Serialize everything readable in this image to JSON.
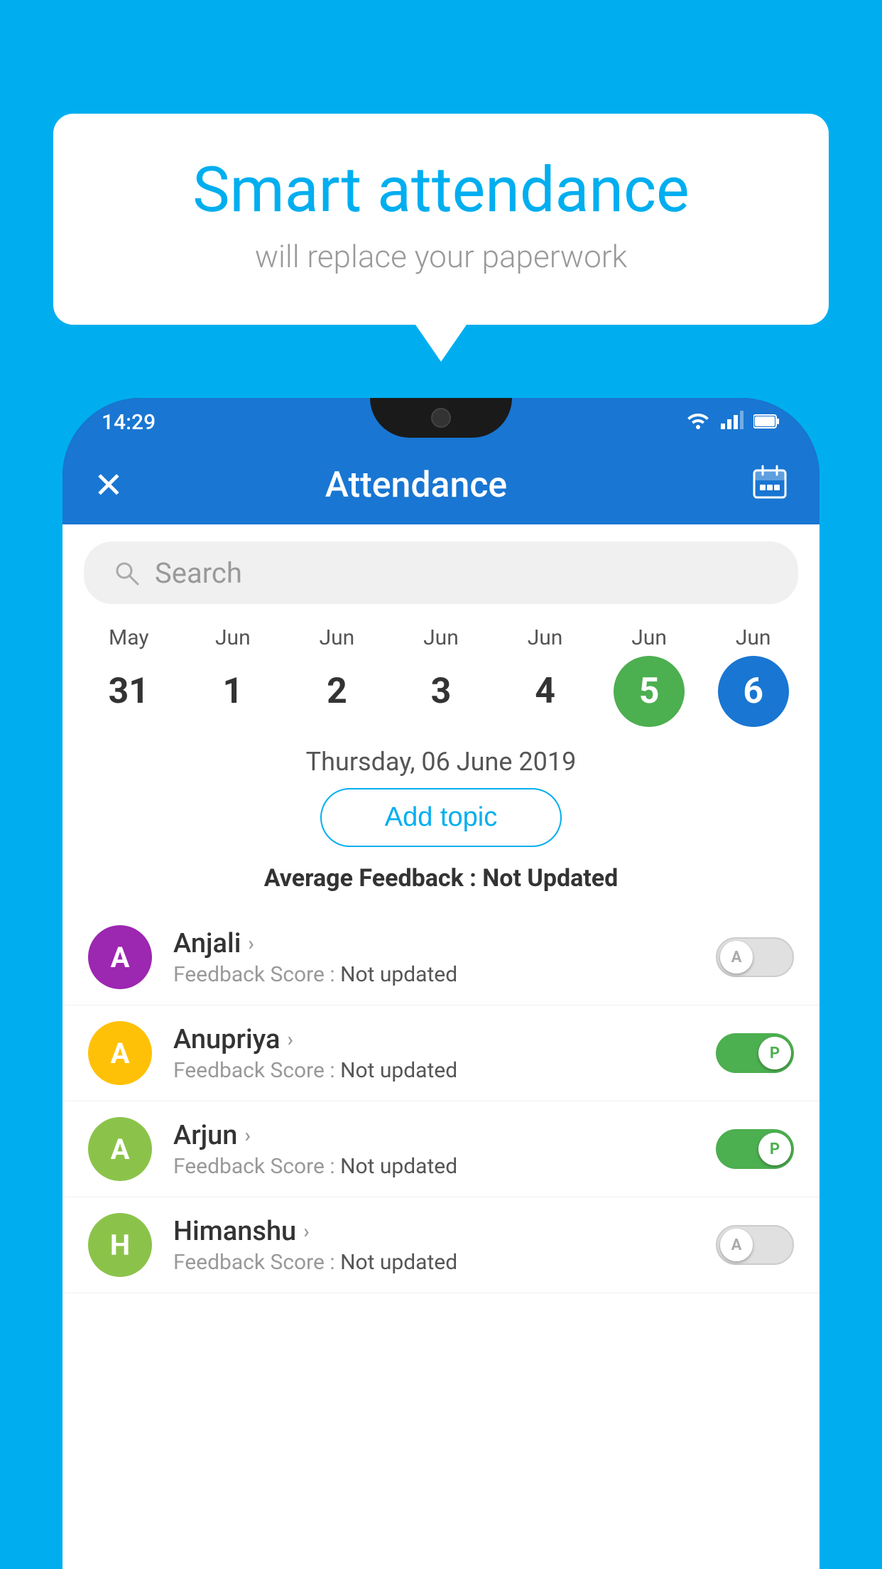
{
  "background_color": "#00AEEF",
  "speech_bubble": {
    "title": "Smart attendance",
    "subtitle": "will replace your paperwork"
  },
  "status_bar": {
    "time": "14:29",
    "icons": [
      "wifi",
      "signal",
      "battery"
    ]
  },
  "app_bar": {
    "title": "Attendance",
    "close_label": "×",
    "calendar_label": "📅"
  },
  "search": {
    "placeholder": "Search"
  },
  "calendar": {
    "days": [
      {
        "month": "May",
        "date": "31",
        "state": "normal"
      },
      {
        "month": "Jun",
        "date": "1",
        "state": "normal"
      },
      {
        "month": "Jun",
        "date": "2",
        "state": "normal"
      },
      {
        "month": "Jun",
        "date": "3",
        "state": "normal"
      },
      {
        "month": "Jun",
        "date": "4",
        "state": "normal"
      },
      {
        "month": "Jun",
        "date": "5",
        "state": "today"
      },
      {
        "month": "Jun",
        "date": "6",
        "state": "selected"
      }
    ]
  },
  "selected_date": "Thursday, 06 June 2019",
  "add_topic_label": "Add topic",
  "avg_feedback": {
    "label": "Average Feedback : ",
    "value": "Not Updated"
  },
  "students": [
    {
      "name": "Anjali",
      "initial": "A",
      "avatar_color": "#9C27B0",
      "feedback": "Not updated",
      "toggle_state": "off",
      "toggle_label": "A"
    },
    {
      "name": "Anupriya",
      "initial": "A",
      "avatar_color": "#FFC107",
      "feedback": "Not updated",
      "toggle_state": "on",
      "toggle_label": "P"
    },
    {
      "name": "Arjun",
      "initial": "A",
      "avatar_color": "#8BC34A",
      "feedback": "Not updated",
      "toggle_state": "on",
      "toggle_label": "P"
    },
    {
      "name": "Himanshu",
      "initial": "H",
      "avatar_color": "#8BC34A",
      "feedback": "Not updated",
      "toggle_state": "off",
      "toggle_label": "A"
    }
  ]
}
